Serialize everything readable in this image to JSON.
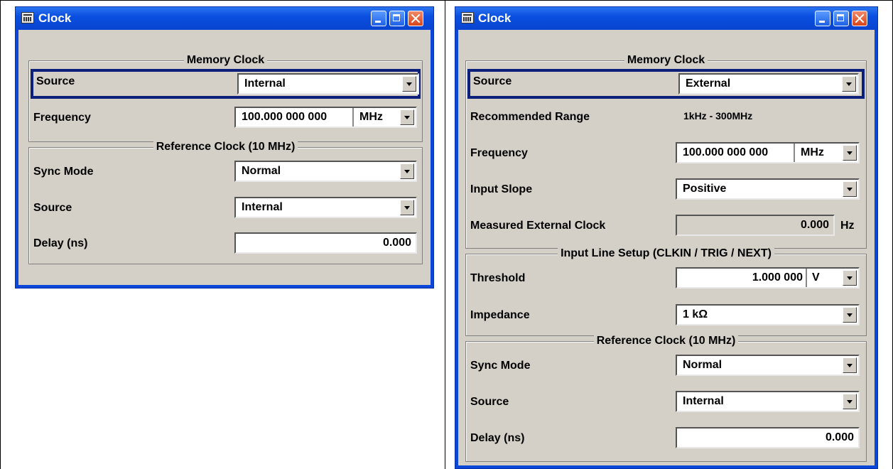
{
  "left": {
    "title": "Clock",
    "memory_clock": {
      "heading": "Memory Clock",
      "source_label": "Source",
      "source_value": "Internal",
      "frequency_label": "Frequency",
      "frequency_value": "100.000 000 000",
      "frequency_unit": "MHz"
    },
    "reference_clock": {
      "heading": "Reference Clock (10 MHz)",
      "sync_label": "Sync Mode",
      "sync_value": "Normal",
      "source_label": "Source",
      "source_value": "Internal",
      "delay_label": "Delay (ns)",
      "delay_value": "0.000"
    }
  },
  "right": {
    "title": "Clock",
    "memory_clock": {
      "heading": "Memory Clock",
      "source_label": "Source",
      "source_value": "External",
      "range_label": "Recommended Range",
      "range_value": "1kHz - 300MHz",
      "frequency_label": "Frequency",
      "frequency_value": "100.000 000 000",
      "frequency_unit": "MHz",
      "slope_label": "Input Slope",
      "slope_value": "Positive",
      "measured_label": "Measured External Clock",
      "measured_value": "0.000",
      "measured_unit": "Hz"
    },
    "input_line": {
      "heading": "Input Line Setup (CLKIN / TRIG / NEXT)",
      "threshold_label": "Threshold",
      "threshold_value": "1.000 000",
      "threshold_unit": "V",
      "impedance_label": "Impedance",
      "impedance_value": "1 kΩ"
    },
    "reference_clock": {
      "heading": "Reference Clock (10 MHz)",
      "sync_label": "Sync Mode",
      "sync_value": "Normal",
      "source_label": "Source",
      "source_value": "Internal",
      "delay_label": "Delay (ns)",
      "delay_value": "0.000"
    }
  }
}
